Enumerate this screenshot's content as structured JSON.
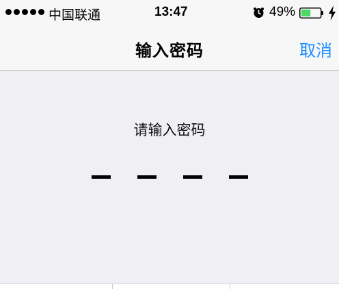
{
  "status_bar": {
    "carrier": "中国联通",
    "time": "13:47",
    "battery_percent": "49%",
    "battery_level": 0.49,
    "signal_bars": 5,
    "icons": [
      "alarm-icon",
      "battery-icon",
      "charging-icon"
    ]
  },
  "nav": {
    "title": "输入密码",
    "cancel_label": "取消"
  },
  "pin": {
    "prompt": "请输入密码",
    "length": 4
  },
  "colors": {
    "accent": "#1a8cff",
    "background": "#efeff4",
    "bar": "#f7f7f7",
    "battery_fill": "#4cd964"
  }
}
